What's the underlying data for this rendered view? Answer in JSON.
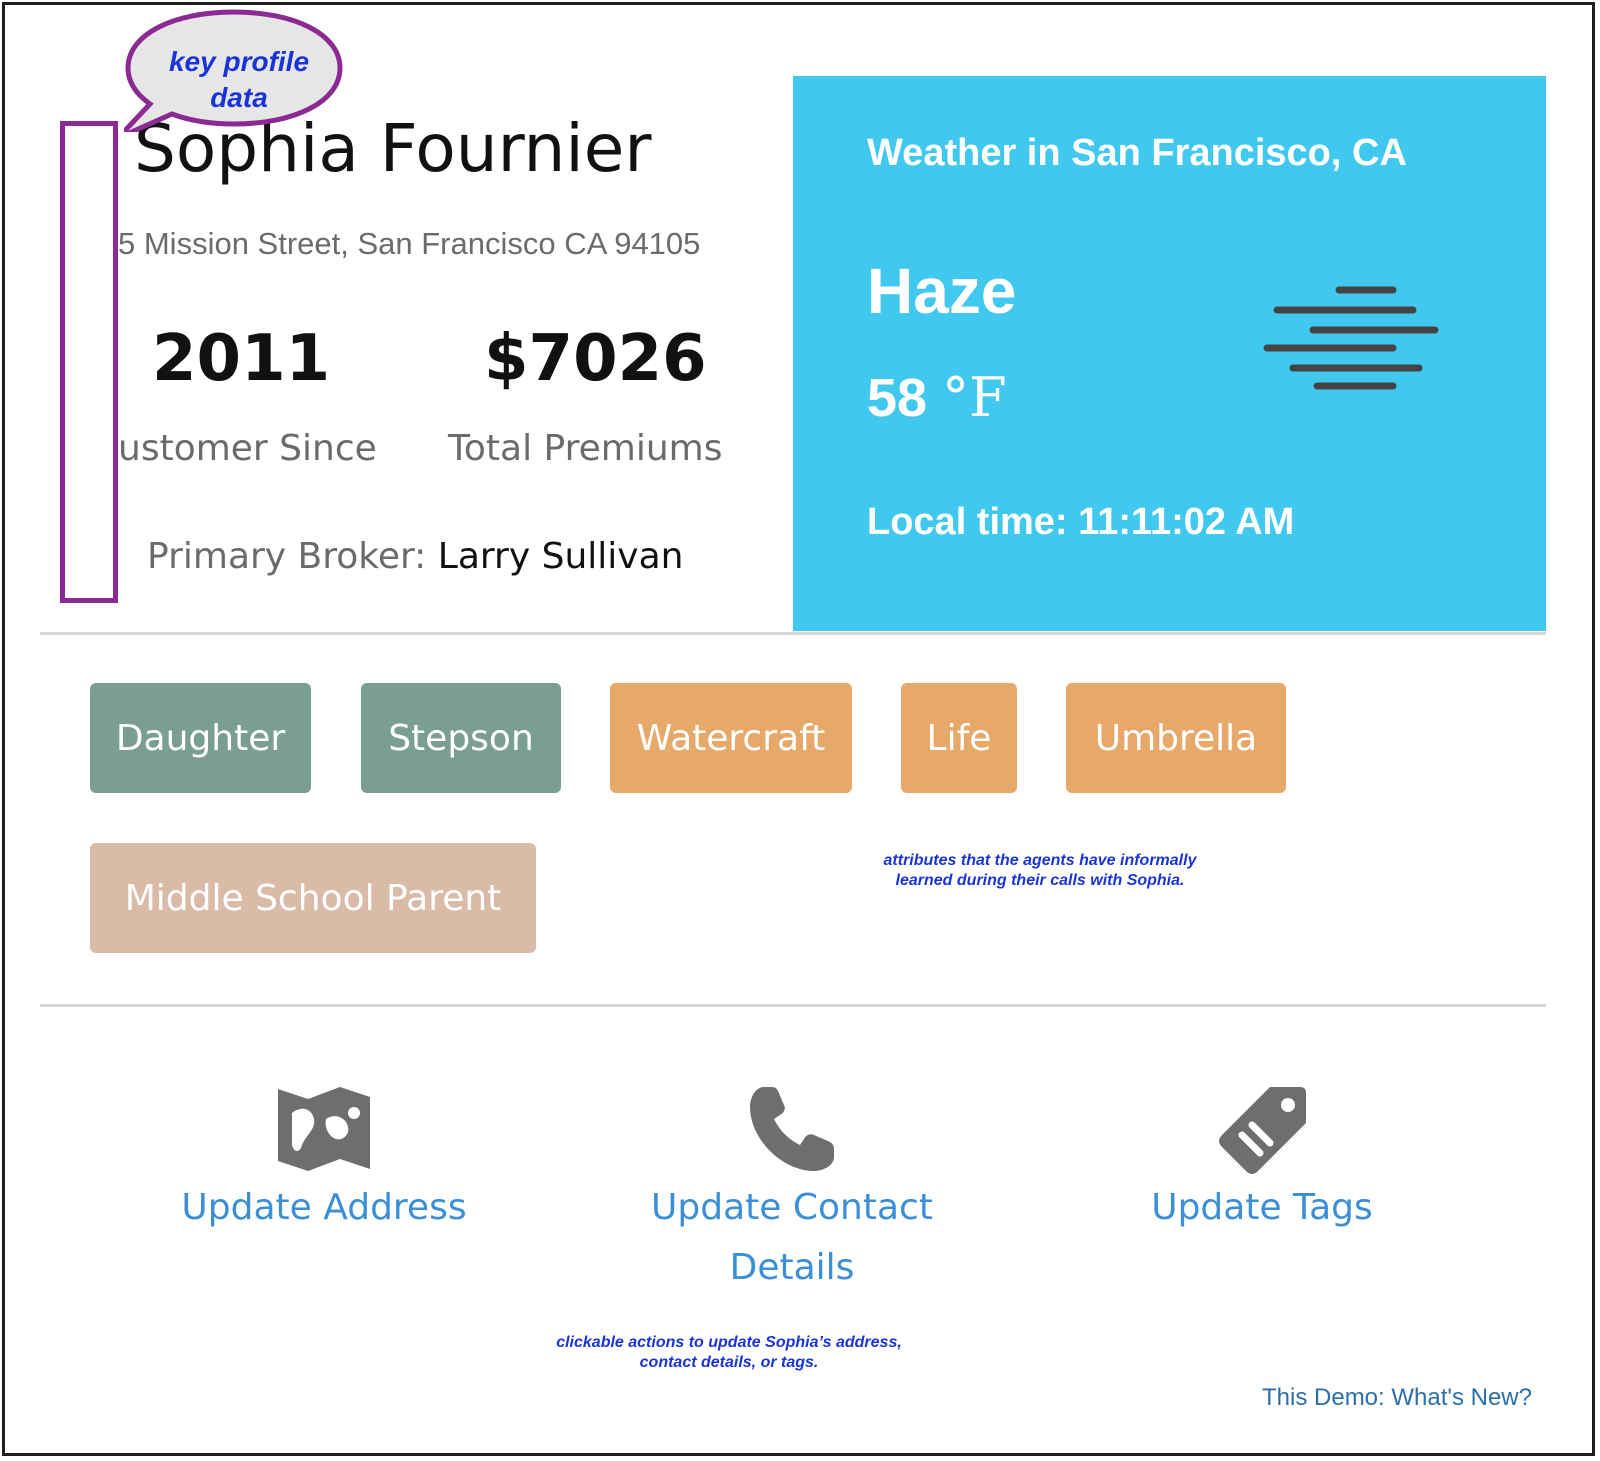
{
  "profile": {
    "name": "Sophia Fournier",
    "address": "5 Mission Street, San Francisco CA 94105",
    "customer_since_value": "2011",
    "customer_since_label": "ustomer Since",
    "total_premiums_value": "$7026",
    "total_premiums_label": "Total Premiums",
    "broker_label": "Primary Broker:",
    "broker_name": "Larry Sullivan"
  },
  "annotations": {
    "key_profile_line1": "key profile",
    "key_profile_line2": "data",
    "tags_note_line1": "attributes  that the agents have informally",
    "tags_note_line2": "learned during their calls with Sophia.",
    "actions_note_line1": "clickable actions to update Sophia’s address,",
    "actions_note_line2": "contact details, or tags.",
    "callout_border_color": "#8c2a93",
    "text_color": "#1a34d6"
  },
  "weather": {
    "title": "Weather in San Francisco, CA",
    "condition": "Haze",
    "temperature": "58",
    "unit": "°F",
    "local_time": "Local time: 11:11:02 AM",
    "icon": "haze-icon",
    "background": "#40c8ee"
  },
  "tags": [
    {
      "label": "Daughter",
      "color": "#7a9e90"
    },
    {
      "label": "Stepson",
      "color": "#7a9e90"
    },
    {
      "label": "Watercraft",
      "color": "#e6a96a"
    },
    {
      "label": "Life",
      "color": "#e6a96a"
    },
    {
      "label": "Umbrella",
      "color": "#e6a96a"
    },
    {
      "label": "Middle School Parent",
      "color": "#d9bba8"
    }
  ],
  "actions": {
    "update_address": {
      "label": "Update Address",
      "icon": "map-icon"
    },
    "update_contact": {
      "line1": "Update Contact",
      "line2": "Details",
      "icon": "phone-icon"
    },
    "update_tags": {
      "label": "Update Tags",
      "icon": "tag-icon"
    }
  },
  "footer": {
    "whats_new": "This Demo: What's New?"
  }
}
